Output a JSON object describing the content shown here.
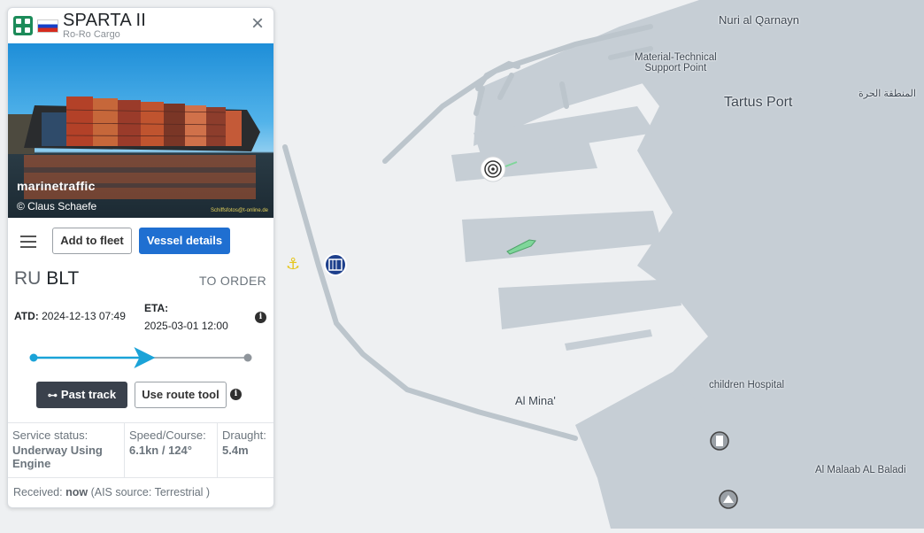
{
  "vessel": {
    "name": "SPARTA II",
    "type": "Ro-Ro Cargo",
    "flag": "Russia",
    "photo_brand": "marinetraffic",
    "photo_credit": "© Claus Schaefe",
    "photo_credit_small": "Schiffsfotos@t-online.de"
  },
  "actions": {
    "add_to_fleet": "Add to fleet",
    "vessel_details": "Vessel details",
    "past_track": "Past track",
    "use_route_tool": "Use route tool"
  },
  "voyage": {
    "from_country": "RU",
    "from_port": "BLT",
    "destination": "TO ORDER",
    "atd_label": "ATD:",
    "atd": "2024-12-13 07:49",
    "eta_label": "ETA:",
    "eta": "2025-03-01 12:00",
    "progress": 0.51
  },
  "status": {
    "service_label": "Service status:",
    "service_value": "Underway Using Engine",
    "speed_label": "Speed/Course:",
    "speed_value": "6.1kn / 124°",
    "draught_label": "Draught:",
    "draught_value": "5.4m"
  },
  "received": {
    "label": "Received:",
    "value": "now",
    "source": "(AIS source: Terrestrial )"
  },
  "map": {
    "labels": {
      "nuri": "Nuri al Qarnayn",
      "material_1": "Material-Technical",
      "material_2": "Support Point",
      "tartus": "Tartus Port",
      "free_zone": "المنطقة الحرة",
      "al_mina": "Al Mina'",
      "hospital": "children Hospital",
      "malaab": "Al Malaab AL Baladi"
    }
  },
  "colors": {
    "sea": "#eef0f2",
    "land": "#c6ced5",
    "primary_button": "#1f6fd1",
    "track_line": "#1ba3d8",
    "vessel_green": "#7fd69a"
  }
}
